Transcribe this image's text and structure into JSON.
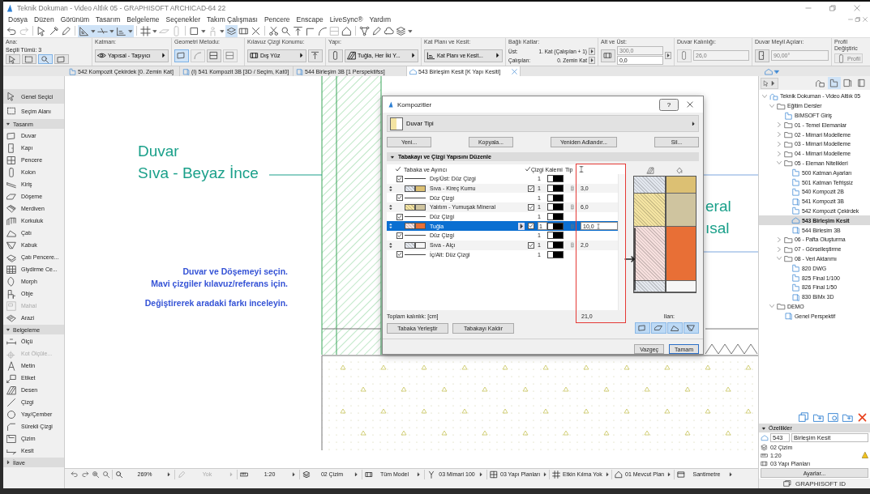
{
  "window": {
    "title": "Teknik Dokuman - Video Altlık 05 - GRAPHISOFT ARCHICAD-64 22"
  },
  "menu": [
    "Dosya",
    "Düzen",
    "Görünüm",
    "Tasarım",
    "Belgeleme",
    "Seçenekler",
    "Takım Çalışması",
    "Pencere",
    "Enscape",
    "LiveSync®",
    "Yardım"
  ],
  "toolbar": [
    {
      "kind": "undo",
      "selected": false,
      "disabled": false
    },
    {
      "kind": "redo",
      "selected": false,
      "disabled": true
    },
    {
      "kind": "sep"
    },
    {
      "kind": "cursor",
      "selected": false,
      "disabled": false
    },
    {
      "kind": "dropper",
      "selected": false,
      "disabled": false
    },
    {
      "kind": "pen",
      "selected": false,
      "disabled": false
    },
    {
      "kind": "sep"
    },
    {
      "kind": "ruler",
      "selected": true,
      "disabled": false
    },
    {
      "kind": "caret",
      "selected": true,
      "disabled": false
    },
    {
      "kind": "guide",
      "selected": true,
      "disabled": false
    },
    {
      "kind": "caret",
      "selected": true,
      "disabled": false
    },
    {
      "kind": "snap",
      "selected": true,
      "disabled": false
    },
    {
      "kind": "caret",
      "selected": true,
      "disabled": false
    },
    {
      "kind": "sep"
    },
    {
      "kind": "grid",
      "selected": false,
      "disabled": false
    },
    {
      "kind": "caret",
      "selected": false,
      "disabled": false
    },
    {
      "kind": "plane",
      "selected": false,
      "disabled": true
    },
    {
      "kind": "column",
      "selected": false,
      "disabled": true
    },
    {
      "kind": "sep"
    },
    {
      "kind": "square",
      "selected": false,
      "disabled": false
    },
    {
      "kind": "caret",
      "selected": false,
      "disabled": false
    },
    {
      "kind": "person",
      "selected": false,
      "disabled": true
    },
    {
      "kind": "caret",
      "selected": false,
      "disabled": false
    },
    {
      "kind": "trace",
      "selected": true,
      "disabled": false
    },
    {
      "kind": "frame",
      "selected": false,
      "disabled": false
    },
    {
      "kind": "cross",
      "selected": false,
      "disabled": false
    },
    {
      "kind": "sep"
    },
    {
      "kind": "scissors",
      "selected": false,
      "disabled": false
    },
    {
      "kind": "magnifier",
      "selected": false,
      "disabled": false
    },
    {
      "kind": "align",
      "selected": false,
      "disabled": false
    },
    {
      "kind": "corner",
      "selected": false,
      "disabled": false
    },
    {
      "kind": "curve",
      "selected": false,
      "disabled": false
    },
    {
      "kind": "box",
      "selected": false,
      "disabled": true
    },
    {
      "kind": "house",
      "selected": false,
      "disabled": false
    },
    {
      "kind": "sep"
    },
    {
      "kind": "network",
      "selected": false,
      "disabled": false
    },
    {
      "kind": "pen",
      "selected": false,
      "disabled": false
    },
    {
      "kind": "cloud",
      "selected": false,
      "disabled": false
    },
    {
      "kind": "layers",
      "selected": false,
      "disabled": false
    },
    {
      "kind": "caret",
      "selected": false,
      "disabled": false
    }
  ],
  "info_box": [
    {
      "label": "Ana:",
      "controls": [
        {
          "kind": "text",
          "text": "Seçili Tümü: 3"
        },
        {
          "kind": "button",
          "selected": false,
          "disabled": false
        },
        {
          "kind": "button",
          "selected": false,
          "disabled": false
        },
        {
          "kind": "button",
          "selected": true,
          "disabled": false
        },
        {
          "kind": "button",
          "selected": false,
          "disabled": false
        }
      ]
    },
    {
      "label": "Katman:",
      "controls": [
        {
          "kind": "dropdown",
          "text": "Yapısal - Taşıyıcı"
        }
      ]
    },
    {
      "label": "Geometri Metodu:",
      "controls": [
        {
          "kind": "button",
          "selected": true,
          "disabled": false
        },
        {
          "kind": "button",
          "selected": false,
          "disabled": true
        },
        {
          "kind": "button",
          "selected": false,
          "disabled": false
        },
        {
          "kind": "button",
          "selected": false,
          "disabled": true
        }
      ]
    },
    {
      "label": "Kılavuz Çizgi Konumu:",
      "controls": [
        {
          "kind": "dropdown",
          "text": "Dış Yüz"
        },
        {
          "kind": "button",
          "selected": false,
          "disabled": false
        }
      ]
    },
    {
      "label": "Yapı:",
      "controls": [
        {
          "kind": "button",
          "selected": false,
          "disabled": false
        },
        {
          "kind": "dropdown",
          "text": "Tuğla, Her İki Y..."
        }
      ]
    },
    {
      "label": "Kat Planı ve Kesit:",
      "controls": [
        {
          "kind": "dropdown",
          "text": "Kat Planı ve Kesit..."
        }
      ]
    },
    {
      "label": "Bağlı Katlar:",
      "controls": [
        {
          "kind": "pair",
          "name": "Üst:",
          "value": "1. Kat (Çalışılan + 1)"
        },
        {
          "kind": "pair",
          "name": "Çalışılan:",
          "value": "0. Zemin Kat"
        }
      ]
    },
    {
      "label": "Alt ve Üst:",
      "controls": [
        {
          "kind": "button",
          "selected": false,
          "disabled": false
        },
        {
          "kind": "stack",
          "fields": [
            {
              "value": "300,0",
              "disabled": true
            },
            {
              "value": "0,0",
              "disabled": false
            }
          ]
        }
      ]
    },
    {
      "label": "Duvar Kalınlığı:",
      "controls": [
        {
          "kind": "button",
          "selected": false,
          "disabled": true
        },
        {
          "kind": "field",
          "value": "26,0",
          "disabled": true
        }
      ]
    },
    {
      "label": "Duvar Meyil Açıları:",
      "controls": [
        {
          "kind": "button",
          "selected": false,
          "disabled": false
        },
        {
          "kind": "field",
          "value": "90,00°",
          "disabled": true
        }
      ]
    },
    {
      "label": "Profil Değiştiric",
      "controls": [
        {
          "kind": "button",
          "text": "Profil",
          "selected": false,
          "disabled": true
        }
      ]
    }
  ],
  "tabs": [
    {
      "kind": "plan",
      "label": "542 Kompozit Çekirdek [0. Zemin Kat]",
      "selected": false
    },
    {
      "kind": "model",
      "label": "(I) 541 Kompozit 3B [3D / Seçim, Kat0]",
      "selected": false
    },
    {
      "kind": "model",
      "label": "544 Birleşim 3B [1 Perspektifss]",
      "selected": false
    },
    {
      "kind": "section",
      "label": "543 Birleşim Kesit [K Yapı Kesiti]",
      "selected": true
    }
  ],
  "toolbox": {
    "items": [
      {
        "kind": "cursor",
        "label": "Genel Seçici",
        "selected": true,
        "disabled": false
      },
      {
        "kind": "dashrect",
        "label": "Seçim Alanı",
        "selected": false,
        "disabled": false
      }
    ],
    "sections": [
      {
        "title": "Tasarım",
        "expanded": true,
        "items": [
          {
            "kind": "wall",
            "label": "Duvar",
            "selected": false,
            "disabled": false
          },
          {
            "kind": "door",
            "label": "Kapı",
            "selected": false,
            "disabled": false
          },
          {
            "kind": "window",
            "label": "Pencere",
            "selected": false,
            "disabled": false
          },
          {
            "kind": "column",
            "label": "Kolon",
            "selected": false,
            "disabled": false
          },
          {
            "kind": "beam",
            "label": "Kiriş",
            "selected": false,
            "disabled": false
          },
          {
            "kind": "slab",
            "label": "Döşeme",
            "selected": false,
            "disabled": false
          },
          {
            "kind": "stair",
            "label": "Merdiven",
            "selected": false,
            "disabled": false
          },
          {
            "kind": "railing",
            "label": "Korkuluk",
            "selected": false,
            "disabled": false
          },
          {
            "kind": "roof",
            "label": "Çatı",
            "selected": false,
            "disabled": false
          },
          {
            "kind": "shell",
            "label": "Kabuk",
            "selected": false,
            "disabled": false
          },
          {
            "kind": "skylight",
            "label": "Çatı Pencere...",
            "selected": false,
            "disabled": false
          },
          {
            "kind": "curtain",
            "label": "Giydirme Ce...",
            "selected": false,
            "disabled": false
          },
          {
            "kind": "morph",
            "label": "Morph",
            "selected": false,
            "disabled": false
          },
          {
            "kind": "chair",
            "label": "Obje",
            "selected": false,
            "disabled": false
          },
          {
            "kind": "zone",
            "label": "Mahal",
            "selected": false,
            "disabled": true
          },
          {
            "kind": "terrain",
            "label": "Arazi",
            "selected": false,
            "disabled": false
          }
        ]
      },
      {
        "title": "Belgeleme",
        "expanded": true,
        "items": [
          {
            "kind": "dimension",
            "label": "Ölçü",
            "selected": false,
            "disabled": false
          },
          {
            "kind": "level",
            "label": "Kot Ölçüle...",
            "selected": false,
            "disabled": true
          },
          {
            "kind": "texttool",
            "label": "Metin",
            "selected": false,
            "disabled": false
          },
          {
            "kind": "label",
            "label": "Etiket",
            "selected": false,
            "disabled": false
          },
          {
            "kind": "hatch",
            "label": "Desen",
            "selected": false,
            "disabled": false
          },
          {
            "kind": "line",
            "label": "Çizgi",
            "selected": false,
            "disabled": false
          },
          {
            "kind": "circle",
            "label": "Yay/Çember",
            "selected": false,
            "disabled": false
          },
          {
            "kind": "polyline",
            "label": "Sürekli Çizgi",
            "selected": false,
            "disabled": false
          },
          {
            "kind": "drawing",
            "label": "Çizim",
            "selected": false,
            "disabled": false
          },
          {
            "kind": "sectionmark",
            "label": "Kesit",
            "selected": false,
            "disabled": false
          }
        ]
      },
      {
        "title": "İlave",
        "expanded": false
      }
    ]
  },
  "canvas": {
    "title": "Duvar",
    "subtitle": "Sıva - Beyaz İnce",
    "notes": [
      "Duvar ve Döşemeyi seçin.",
      "Mavi çizgiler kılavuz/referans için.",
      "Değiştirerek aradaki farkı inceleyin."
    ],
    "partial_labels": [
      "eral",
      "ısal"
    ]
  },
  "dialog": {
    "title": "Kompozitler",
    "help": "?",
    "type_selector": "Duvar Tipi",
    "buttons": [
      "Yeni...",
      "Kopyala...",
      "Yeniden Adlandır...",
      "Sil..."
    ],
    "section": {
      "title": "Tabakayı ve Çizgi Yapısını Düzenle",
      "expanded": true
    },
    "columns": {
      "layer": "Tabaka ve Ayırıcı",
      "pen": "Çizgi Kalemi",
      "type": "Tip"
    },
    "rows": [
      {
        "kind": "line",
        "checked": true,
        "name": "Dış/Üst: Düz Çizgi",
        "pen": "1",
        "selected": false
      },
      {
        "kind": "layer",
        "name": "Sıva - Kireç Kumu",
        "swatches": [
          {
            "kind": "hatch",
            "color": "#e2e7ee"
          },
          {
            "kind": "solid",
            "color": "#dcc073"
          }
        ],
        "core": true,
        "pen": "1",
        "thickness": "3,0",
        "selected": false
      },
      {
        "kind": "line",
        "checked": true,
        "name": "Düz Çizgi",
        "pen": "1",
        "selected": false
      },
      {
        "kind": "layer",
        "name": "Yalıtım - Yumuşak Mineral",
        "swatches": [
          {
            "kind": "hatch",
            "color": "#f4e4a2"
          },
          {
            "kind": "solid",
            "color": "#cfc49f"
          }
        ],
        "core": true,
        "pen": "1",
        "thickness": "6,0",
        "selected": false
      },
      {
        "kind": "line",
        "checked": true,
        "name": "Düz Çizgi",
        "pen": "1",
        "selected": false
      },
      {
        "kind": "layer",
        "name": "Tuğla",
        "swatches": [
          {
            "kind": "hatch",
            "color": "#f6dfdd"
          },
          {
            "kind": "solid",
            "color": "#e86f36"
          }
        ],
        "core": true,
        "pen": "1",
        "thickness": "10,0",
        "selected": true
      },
      {
        "kind": "line",
        "checked": true,
        "name": "Düz Çizgi",
        "pen": "1",
        "selected": false
      },
      {
        "kind": "layer",
        "name": "Sıva - Alçı",
        "swatches": [
          {
            "kind": "hatch",
            "color": "#e4e8ee"
          },
          {
            "kind": "solid",
            "color": "#f6f6f6"
          }
        ],
        "core": true,
        "pen": "1",
        "thickness": "2,0",
        "selected": false
      },
      {
        "kind": "line",
        "checked": true,
        "name": "İç/Alt: Düz Çizgi",
        "pen": "1",
        "selected": false
      }
    ],
    "total_label": "Toplam kalınlık: [cm]",
    "total": "21,0",
    "preview_label": "Ilan:",
    "shape_buttons": [
      {
        "kind": "wall",
        "selected": true
      },
      {
        "kind": "slab",
        "selected": true
      },
      {
        "kind": "roof",
        "selected": true
      },
      {
        "kind": "shell",
        "selected": true
      }
    ],
    "layer_buttons": [
      "Tabaka Yerleştir",
      "Tabakayı Kaldır"
    ],
    "cancel": "Vazgeç",
    "ok": "Tamam"
  },
  "navigator": {
    "modes": [
      {
        "kind": "project",
        "selected": false
      },
      {
        "kind": "views",
        "selected": true
      },
      {
        "kind": "layouts",
        "selected": false
      },
      {
        "kind": "publish",
        "selected": false
      }
    ],
    "tree": [
      {
        "kind": "project",
        "label": "Teknik Dokuman - Video Altlık 05",
        "expanded": true,
        "selected": false,
        "children": [
          {
            "kind": "folder",
            "label": "Eğitim Dersler",
            "expanded": true,
            "selected": false,
            "children": [
              {
                "kind": "plan",
                "label": "BIMSOFT Giriş",
                "selected": false
              },
              {
                "kind": "folder",
                "label": "01 - Temel Elemanlar",
                "expanded": false,
                "selected": false
              },
              {
                "kind": "folder",
                "label": "02 - Mimari Modelleme",
                "expanded": false,
                "selected": false
              },
              {
                "kind": "folder",
                "label": "03 - Mimari Modelleme",
                "expanded": false,
                "selected": false
              },
              {
                "kind": "folder",
                "label": "04 - Mimari Modelleme",
                "expanded": false,
                "selected": false
              },
              {
                "kind": "folder",
                "label": "05 - Eleman Nitelikleri",
                "expanded": true,
                "selected": false,
                "children": [
                  {
                    "kind": "plan",
                    "label": "500 Katman Ayarları",
                    "selected": false
                  },
                  {
                    "kind": "plan",
                    "label": "501 Katman Tefrişsiz",
                    "selected": false
                  },
                  {
                    "kind": "plan",
                    "label": "540 Kompozit 2B",
                    "selected": false
                  },
                  {
                    "kind": "model",
                    "label": "541 Kompozit 3B",
                    "selected": false
                  },
                  {
                    "kind": "plan",
                    "label": "542 Kompozit Çekirdek",
                    "selected": false
                  },
                  {
                    "kind": "section",
                    "label": "543 Birleşim Kesit",
                    "selected": true
                  },
                  {
                    "kind": "model",
                    "label": "544 Birlesim 3B",
                    "selected": false
                  }
                ]
              },
              {
                "kind": "folder",
                "label": "06 - Pafta Oluşturma",
                "expanded": false,
                "selected": false
              },
              {
                "kind": "folder",
                "label": "07 - Görselleştirme",
                "expanded": false,
                "selected": false
              },
              {
                "kind": "folder",
                "label": "08 - Veri Aktarımı",
                "expanded": true,
                "selected": false,
                "children": [
                  {
                    "kind": "plan",
                    "label": "820 DWG",
                    "selected": false
                  },
                  {
                    "kind": "plan",
                    "label": "825 Final 1/100",
                    "selected": false
                  },
                  {
                    "kind": "plan",
                    "label": "826 Final 1/50",
                    "selected": false
                  },
                  {
                    "kind": "model",
                    "label": "830 BIMx 3D",
                    "selected": false
                  }
                ]
              }
            ]
          },
          {
            "kind": "folder",
            "label": "DEMO",
            "expanded": true,
            "selected": false,
            "children": [
              {
                "kind": "model",
                "label": "Genel Perspektif",
                "selected": false
              }
            ]
          }
        ]
      }
    ],
    "properties": {
      "title": "Özellikler",
      "expanded": true,
      "id": "543",
      "name": "Birleşim Kesit",
      "rows": [
        {
          "kind": "layers",
          "text": "02 Çizim",
          "warning": false
        },
        {
          "kind": "scale",
          "text": "1:20",
          "warning": true
        },
        {
          "kind": "frame",
          "text": "03 Yapı Planları",
          "warning": false
        }
      ],
      "button": "Ayarlar..."
    },
    "account": "GRAPHISOFT ID"
  },
  "status_bar": [
    {
      "kind": "magnifier",
      "text": "269%",
      "disabled": false
    },
    {
      "kind": "pen",
      "text": "Yok",
      "disabled": true
    },
    {
      "kind": "scale",
      "text": "1:20",
      "disabled": false
    },
    {
      "kind": "layers",
      "text": "02 Çizim",
      "disabled": false
    },
    {
      "kind": "frame",
      "text": "Tüm Model",
      "disabled": false
    },
    {
      "kind": "nib",
      "text": "03 Mimari 100",
      "disabled": false
    },
    {
      "kind": "window",
      "text": "03 Yapı Planları",
      "disabled": false
    },
    {
      "kind": "grid",
      "text": "Etkin Kılma Yok",
      "disabled": false
    },
    {
      "kind": "house",
      "text": "01 Mevcut Plan",
      "disabled": false
    },
    {
      "kind": "unit",
      "text": "Santimetre",
      "disabled": false
    }
  ]
}
